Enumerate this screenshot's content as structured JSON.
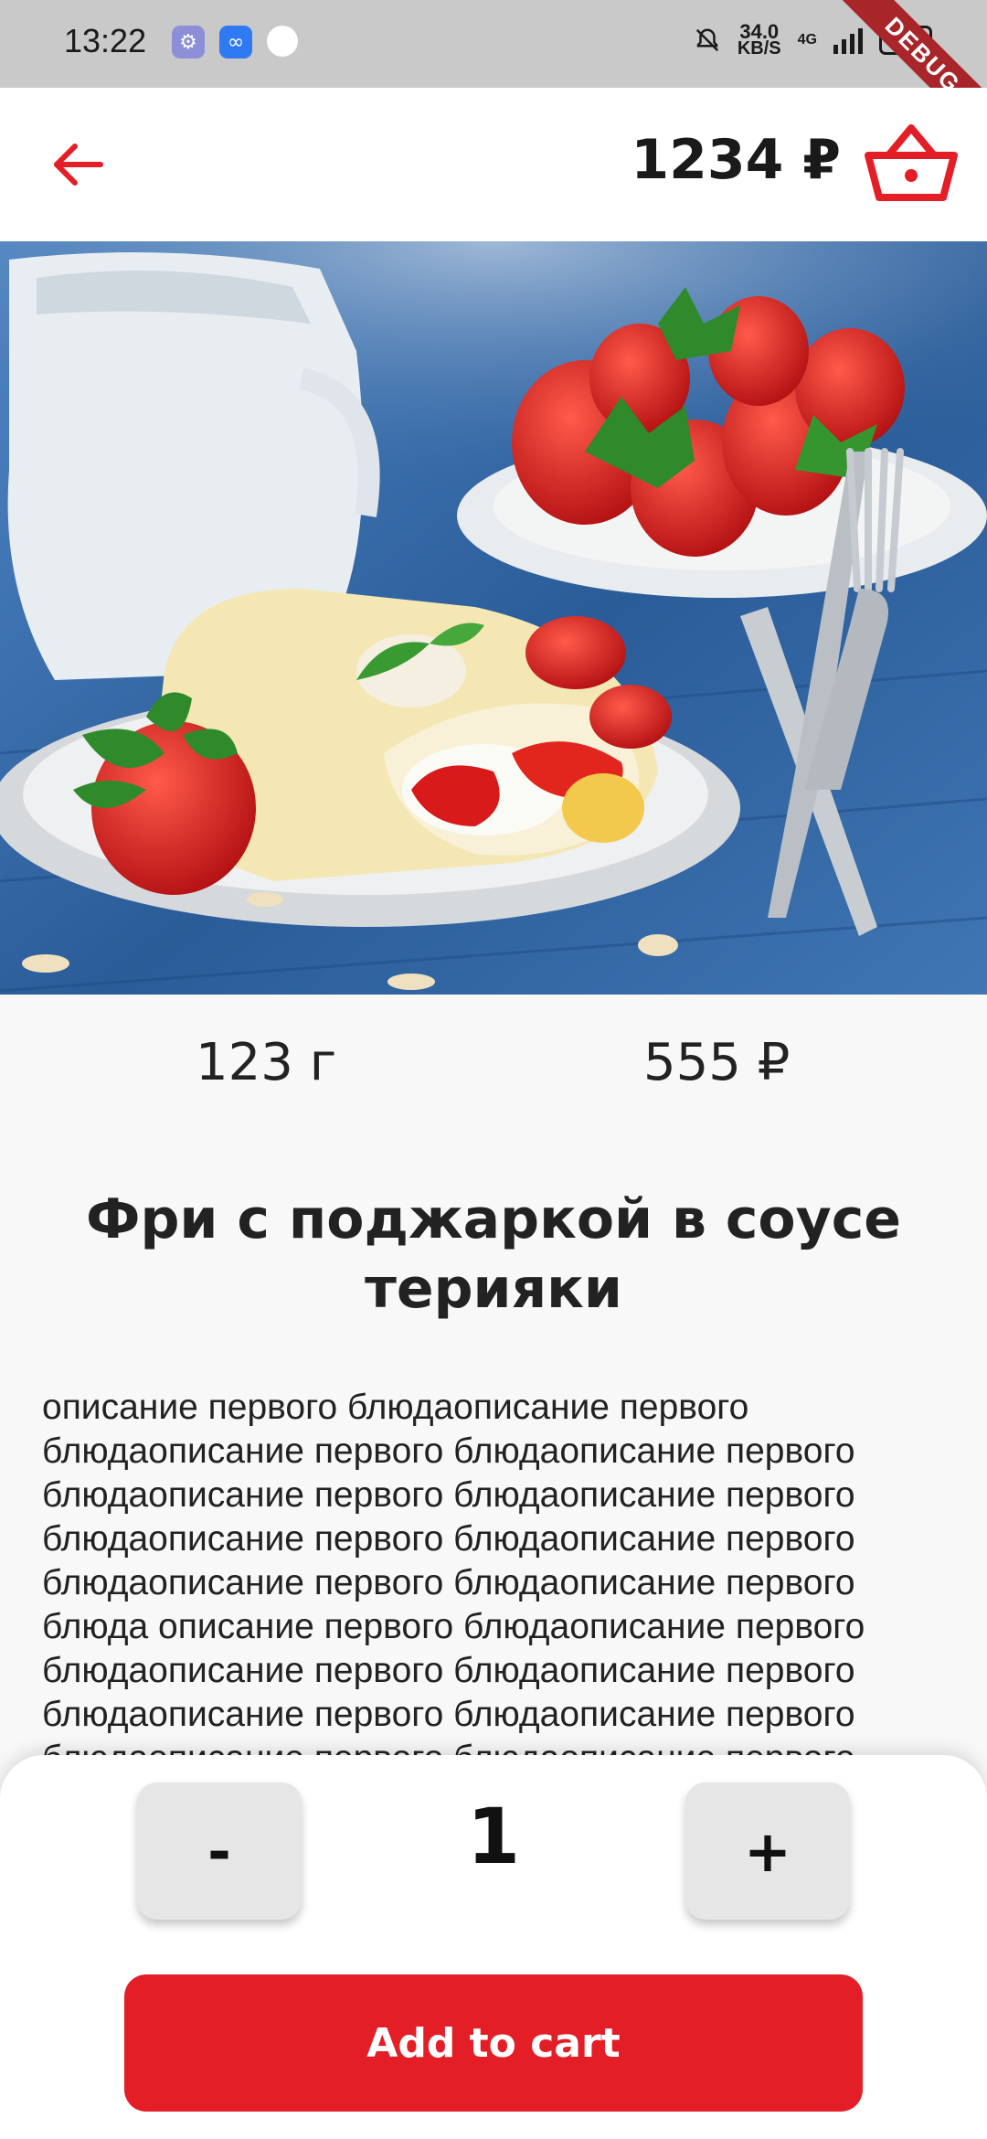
{
  "status_bar": {
    "time": "13:22",
    "speed_value": "34.0",
    "speed_unit": "KB/S",
    "network": "4G",
    "battery": "100"
  },
  "debug_ribbon": "DEBUG",
  "header": {
    "cart_total": "1234 ₽",
    "back_icon": "arrow-left-icon",
    "basket_icon": "basket-icon",
    "accent_color": "#e31e26"
  },
  "product": {
    "image_alt": "crepe-with-strawberries-photo",
    "weight": "123 г",
    "price": "555 ₽",
    "title": "Фри с поджаркой в соусе терияки",
    "description": "описание первого блюдаописание первого блюдаописание первого блюдаописание первого блюдаописание первого блюдаописание первого блюдаописание первого блюдаописание первого блюдаописание первого блюдаописание первого блюда описание первого блюдаописание первого блюдаописание первого блюдаописание первого блюдаописание первого блюдаописание первого блюдаописание первого блюдаописание первого блюдаописание"
  },
  "cart_sheet": {
    "minus_label": "-",
    "quantity": "1",
    "plus_label": "+",
    "add_button_label": "Add to cart"
  }
}
